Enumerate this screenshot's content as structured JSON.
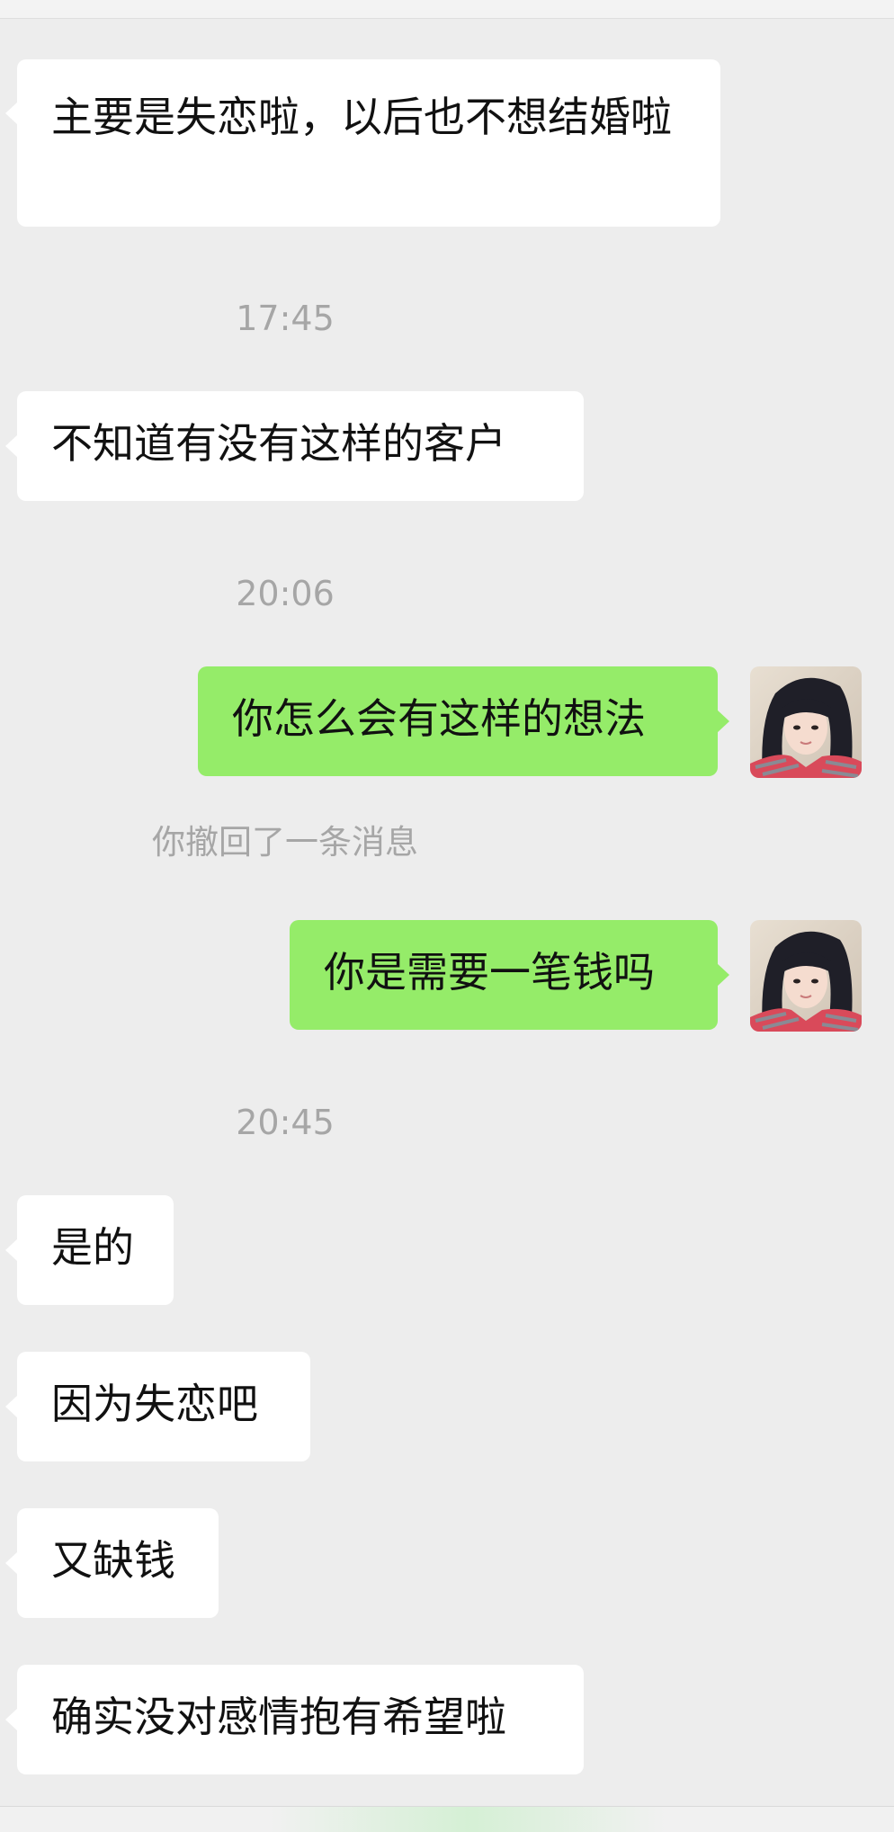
{
  "messages": {
    "m1": "主要是失恋啦，以后也不想结婚啦",
    "t1": "17:45",
    "m2": "不知道有没有这样的客户",
    "t2": "20:06",
    "s1": "你怎么会有这样的想法",
    "recall": "你撤回了一条消息",
    "s2": "你是需要一笔钱吗",
    "t3": "20:45",
    "m3": "是的",
    "m4": "因为失恋吧",
    "m5": "又缺钱",
    "m6": "确实没对感情抱有希望啦"
  },
  "colors": {
    "background": "#ededed",
    "sent_bubble": "#95ec69",
    "received_bubble": "#ffffff",
    "timestamp_text": "#a6a6a6"
  },
  "icons": {
    "self_avatar": "user-avatar-photo"
  }
}
